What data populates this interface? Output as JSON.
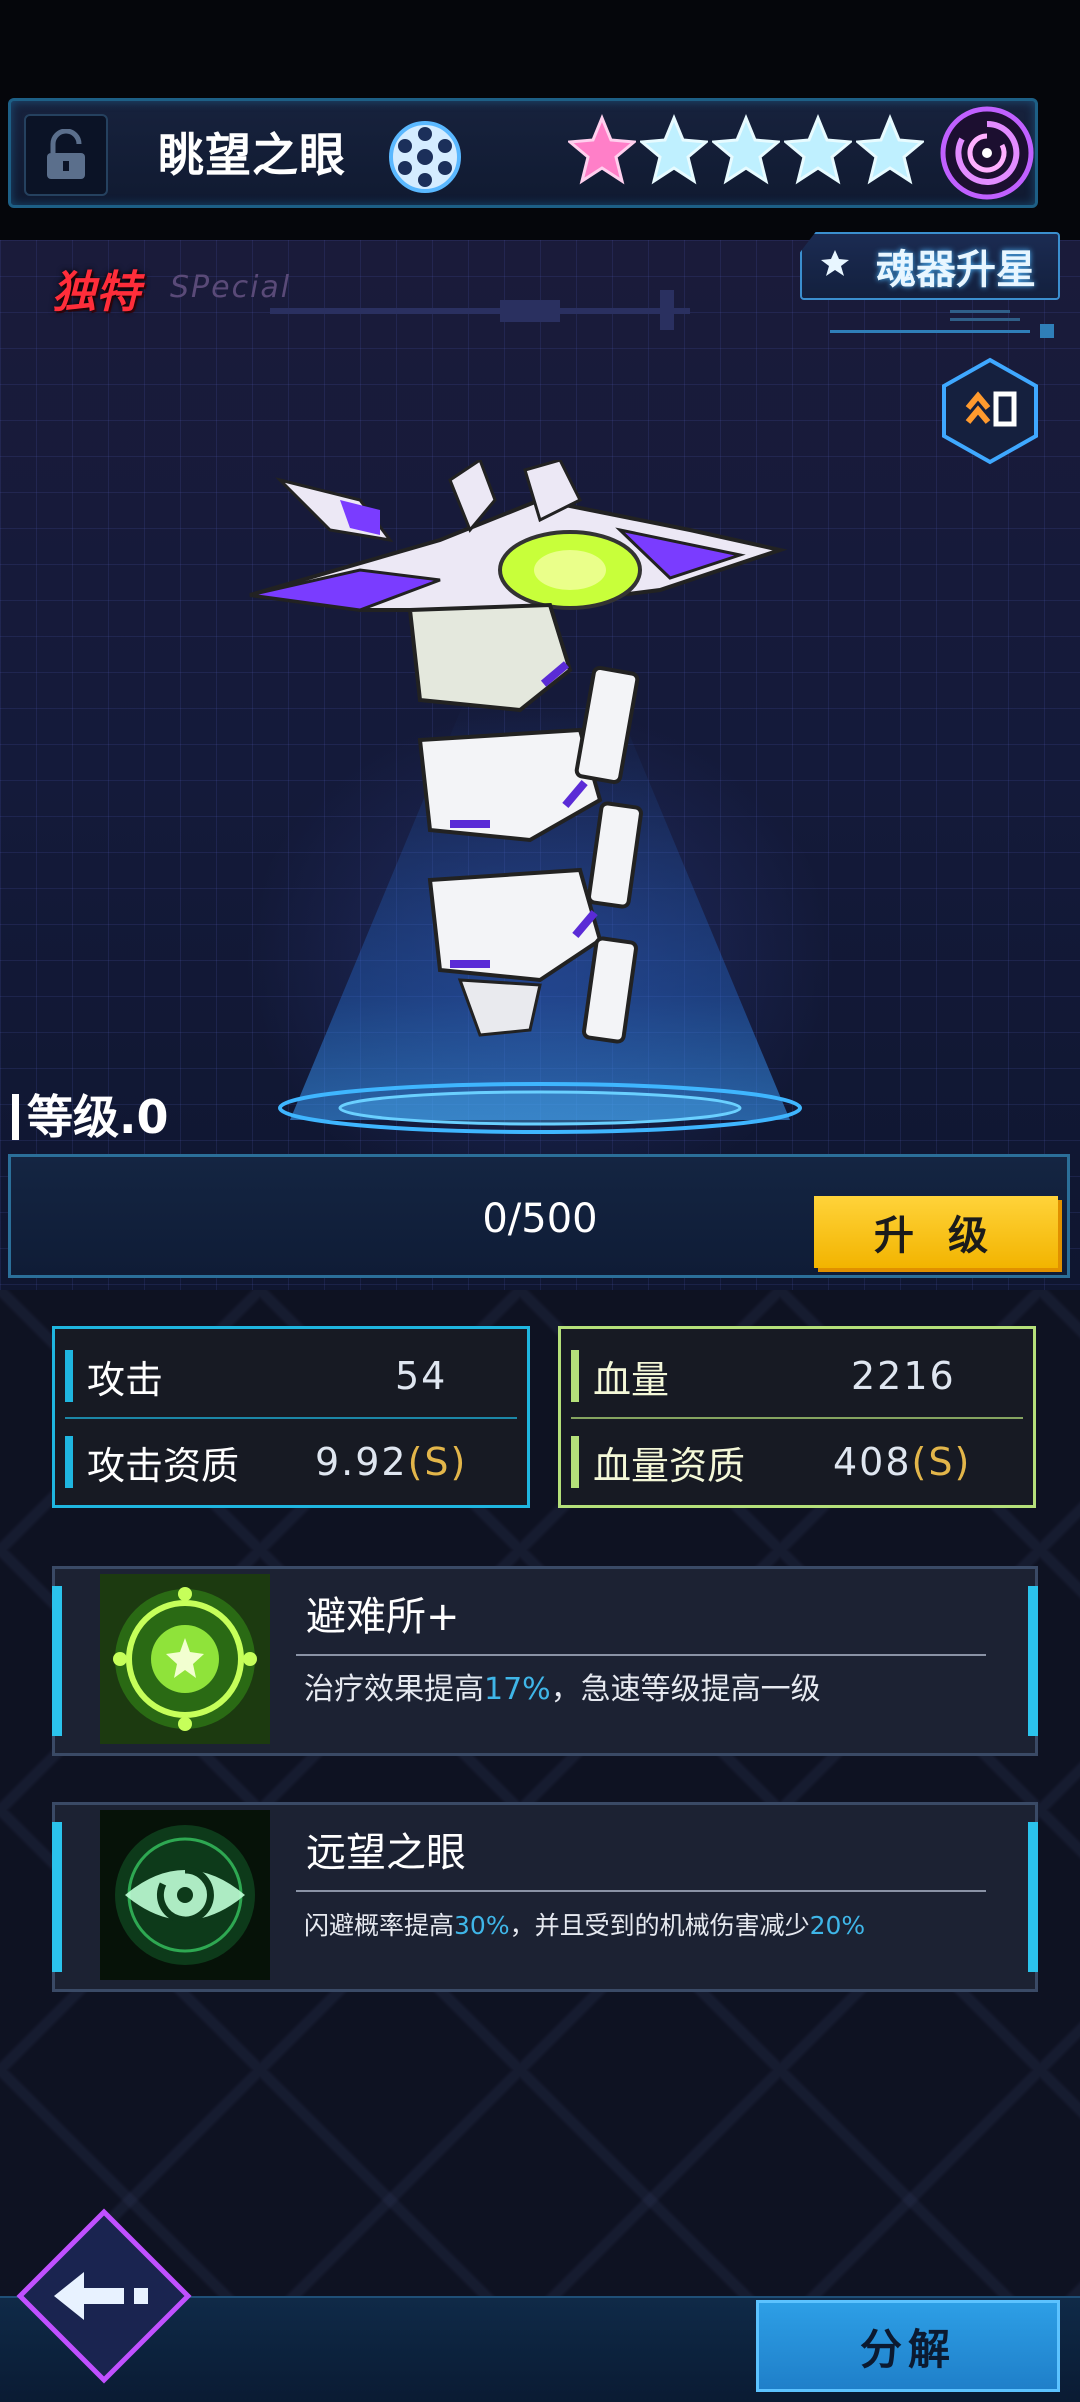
{
  "header": {
    "weapon_name": "眺望之眼",
    "stars_filled": 1,
    "stars_total": 5
  },
  "badges": {
    "rarity": "独特",
    "rarity_sub": "SPecial"
  },
  "buttons": {
    "soul_star": "魂器升星",
    "upgrade": "升 级",
    "decompose": "分解"
  },
  "level": {
    "label": "等级.0",
    "progress_text": "0/500",
    "progress": 0.0
  },
  "stats": {
    "attack": {
      "label": "攻击",
      "value": "54"
    },
    "attack_quality": {
      "label": "攻击资质",
      "value": "9.92",
      "grade": "(S)"
    },
    "hp": {
      "label": "血量",
      "value": "2216"
    },
    "hp_quality": {
      "label": "血量资质",
      "value": "408",
      "grade": "(S)"
    }
  },
  "skills": [
    {
      "name": "避难所+",
      "desc_a": "治疗效果提高",
      "desc_hl1": "17%",
      "desc_b": "，急速等级提高一级"
    },
    {
      "name": "远望之眼",
      "desc_a": "闪避概率提高",
      "desc_hl1": "30%",
      "desc_b": "，并且受到的机械伤害减少",
      "desc_hl2": "20%"
    }
  ],
  "colors": {
    "accent_cyan": "#1fb6e0",
    "accent_green": "#b5e07a",
    "gold": "#f2b400",
    "rarity_red": "#ff2d3a",
    "star_pink": "#ff7fc8",
    "star_empty": "#bff0ff"
  }
}
